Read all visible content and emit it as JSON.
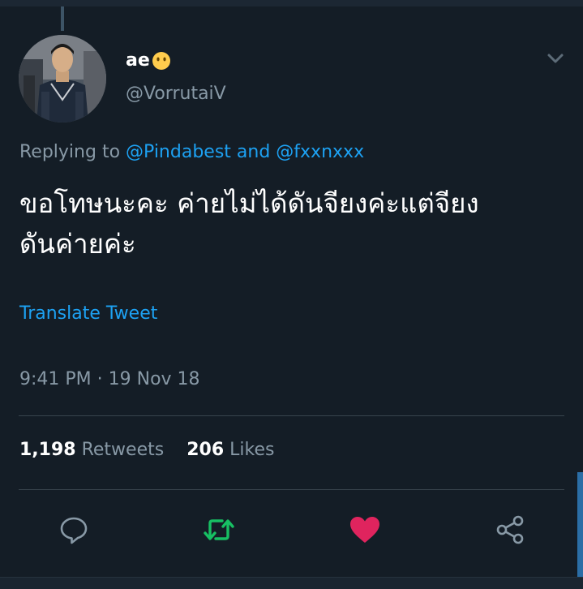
{
  "tweet": {
    "author": {
      "display_name": "ae",
      "emoji": "no-mouth-face-emoji",
      "handle": "@VorrutaiV"
    },
    "replying_to": {
      "prefix": "Replying to",
      "user1": "@Pindabest",
      "conjunction": "and",
      "user2": "@fxxnxxx"
    },
    "text_line1": "ขอโทษนะคะ ค่ายไม่ได้ดันจียงค่ะแต่จียง",
    "text_line2": "ดันค่ายค่ะ",
    "translate_label": "Translate Tweet",
    "timestamp": "9:41 PM · 19 Nov 18"
  },
  "stats": {
    "retweets_count": "1,198",
    "retweets_label": "Retweets",
    "likes_count": "206",
    "likes_label": "Likes"
  },
  "actions": [
    {
      "icon": "reply-icon",
      "color": "#8899a6"
    },
    {
      "icon": "retweet-icon",
      "color": "#17bf63"
    },
    {
      "icon": "heart-icon",
      "color": "#e0245e"
    },
    {
      "icon": "share-icon",
      "color": "#8899a6"
    }
  ],
  "colors": {
    "background": "#141d26",
    "accent": "#1da1f2",
    "muted": "#8899a6",
    "retweet_active": "#17bf63",
    "like_active": "#e0245e"
  }
}
